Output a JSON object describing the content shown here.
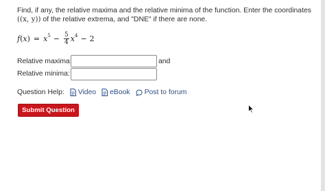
{
  "question": {
    "text_part1": "Find, if any, the relative maxima and the relative minima of the function. Enter the coordinates ",
    "coord_notation": "((x, y))",
    "text_part2": " of the relative extrema, and \"DNE\" if there are none."
  },
  "formula": {
    "lhs": "f",
    "arg_open": "(",
    "arg_var": "x",
    "arg_close": ")",
    "equals": "=",
    "term1_var": "x",
    "term1_exp": "5",
    "minus1": "−",
    "frac_num": "5",
    "frac_den": "4",
    "term2_var": "x",
    "term2_exp": "4",
    "minus2": "−",
    "const": "2"
  },
  "answers": {
    "maxima_label": "Relative maxima:",
    "maxima_value": "",
    "and_text": "and",
    "minima_label": "Relative minima:",
    "minima_value": ""
  },
  "help": {
    "label": "Question Help:",
    "links": [
      {
        "label": "Video",
        "icon": "document-icon"
      },
      {
        "label": "eBook",
        "icon": "document-icon"
      },
      {
        "label": "Post to forum",
        "icon": "speech-bubble-icon"
      }
    ]
  },
  "submit": {
    "label": "Submit Question",
    "color": "#c8161d"
  },
  "colors": {
    "link": "#2a4e8a",
    "text": "#2d2d2d"
  }
}
